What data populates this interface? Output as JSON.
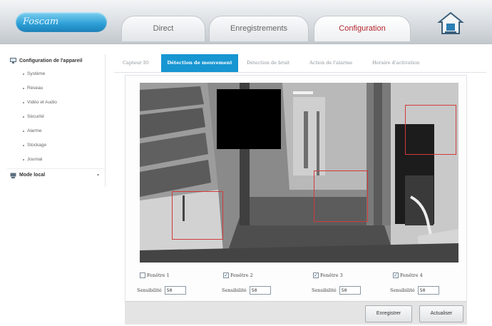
{
  "header": {
    "logo_text": "Foscam",
    "tabs": [
      {
        "label": "Direct"
      },
      {
        "label": "Enregistrements"
      },
      {
        "label": "Configuration"
      }
    ]
  },
  "sidebar": {
    "section_title": "Configuration de l'appareil",
    "items": [
      {
        "label": "Système"
      },
      {
        "label": "Réseau"
      },
      {
        "label": "Vidéo et Audio"
      },
      {
        "label": "Sécurité"
      },
      {
        "label": "Alarme"
      },
      {
        "label": "Stockage"
      },
      {
        "label": "Journal"
      }
    ],
    "local_mode_label": "Mode local"
  },
  "subtabs": [
    {
      "label": "Capteur IO"
    },
    {
      "label": "Détection de mouvement"
    },
    {
      "label": "Détection de bruit"
    },
    {
      "label": "Action de l'alarme"
    },
    {
      "label": "Horaire d'activation"
    }
  ],
  "windows": [
    {
      "label": "Fenêtre 1",
      "checked": false,
      "sensitivity_label": "Sensibilité",
      "sensitivity": "50"
    },
    {
      "label": "Fenêtre 2",
      "checked": true,
      "sensitivity_label": "Sensibilité",
      "sensitivity": "50"
    },
    {
      "label": "Fenêtre 3",
      "checked": true,
      "sensitivity_label": "Sensibilité",
      "sensitivity": "50"
    },
    {
      "label": "Fenêtre 4",
      "checked": true,
      "sensitivity_label": "Sensibilité",
      "sensitivity": "50"
    }
  ],
  "buttons": {
    "save": "Enregistrer",
    "refresh": "Actualiser"
  },
  "colors": {
    "accent": "#1796d2",
    "active_tab_text": "#b3262d",
    "zone_border": "#d23a3a"
  }
}
